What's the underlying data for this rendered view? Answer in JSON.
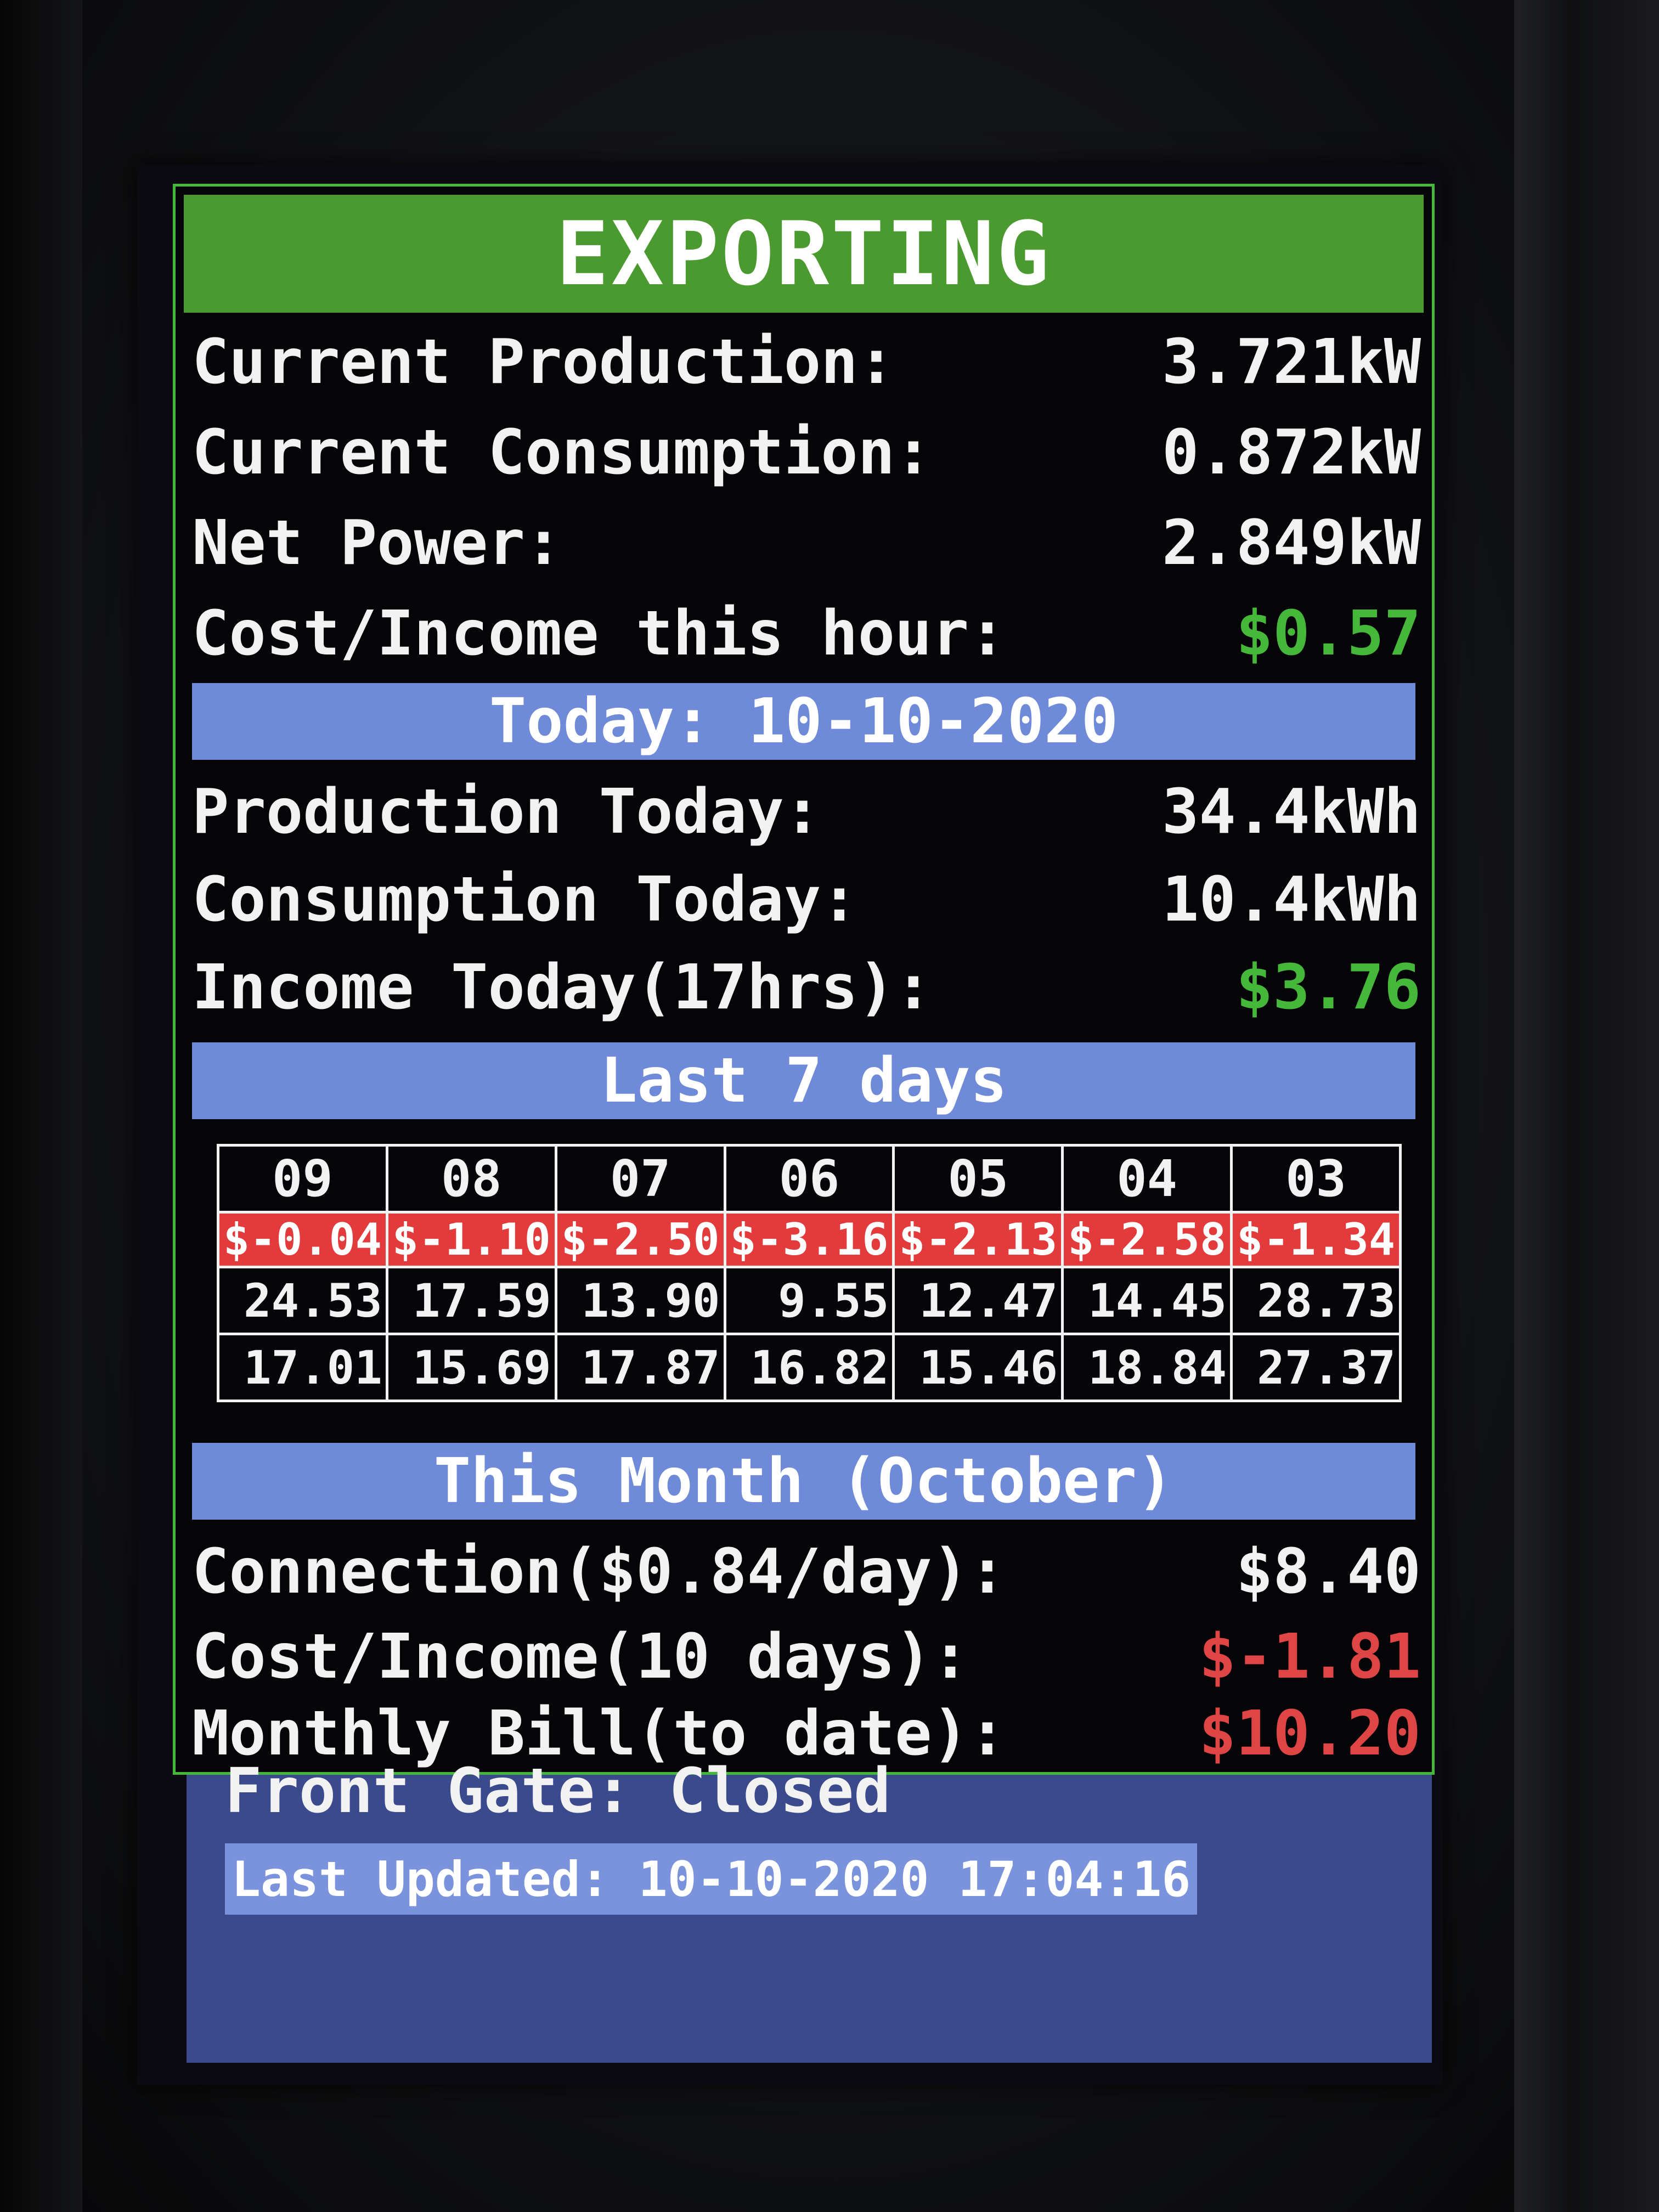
{
  "status": "EXPORTING",
  "current": {
    "production_label": "Current Production:",
    "production_value": "3.721kW",
    "consumption_label": "Current Consumption:",
    "consumption_value": "0.872kW",
    "net_label": "Net Power:",
    "net_value": "2.849kW",
    "hour_label": "Cost/Income this hour:",
    "hour_value": "$0.57"
  },
  "today": {
    "header": "Today: 10-10-2020",
    "production_label": "Production Today:",
    "production_value": "34.4kWh",
    "consumption_label": "Consumption Today:",
    "consumption_value": "10.4kWh",
    "income_label": "Income Today(17hrs):",
    "income_value": "$3.76"
  },
  "last7": {
    "header": "Last 7 days",
    "days": [
      "09",
      "08",
      "07",
      "06",
      "05",
      "04",
      "03"
    ],
    "costs": [
      "$-0.04",
      "$-1.10",
      "$-2.50",
      "$-3.16",
      "$-2.13",
      "$-2.58",
      "$-1.34"
    ],
    "production": [
      "24.53",
      "17.59",
      "13.90",
      "9.55",
      "12.47",
      "14.45",
      "28.73"
    ],
    "consumption": [
      "17.01",
      "15.69",
      "17.87",
      "16.82",
      "15.46",
      "18.84",
      "27.37"
    ]
  },
  "month": {
    "header": "This Month (October)",
    "connection_label": "Connection($0.84/day):",
    "connection_value": "$8.40",
    "cost_label": "Cost/Income(10 days):",
    "cost_value": "$-1.81",
    "bill_label": "Monthly Bill(to date):",
    "bill_value": "$10.20"
  },
  "gate": "Front Gate: Closed",
  "last_updated": "Last Updated: 10-10-2020 17:04:16",
  "colors": {
    "banner": "#4a9a30",
    "section": "#6f8ad8",
    "income_green": "#45b83a",
    "cost_red": "#e04545",
    "cost_row": "#e33b3b",
    "border": "#45b83a"
  }
}
